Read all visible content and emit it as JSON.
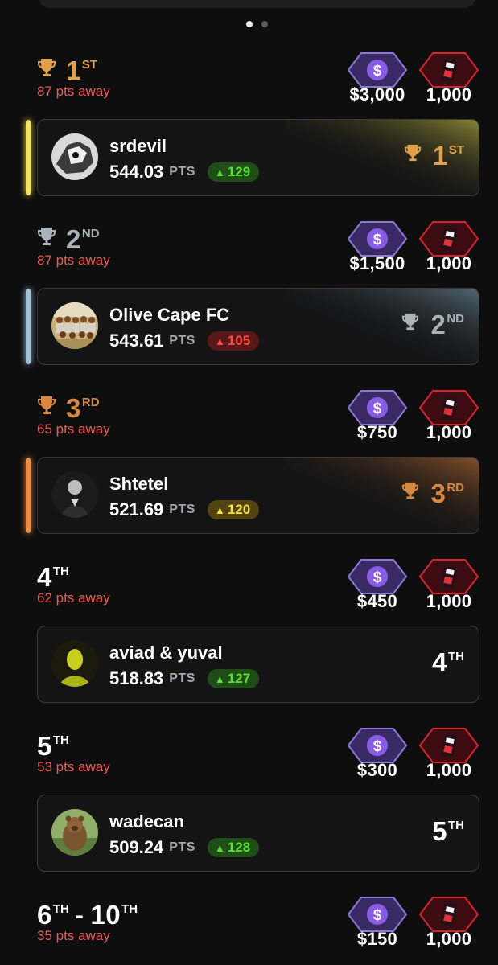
{
  "pager": {
    "dots": [
      "page-1",
      "page-2"
    ],
    "active": 0
  },
  "colors": {
    "gold": "#e0a14a",
    "silver": "#a9b3ba",
    "bronze": "#d9883f",
    "away": "#f0584f"
  },
  "tiers": [
    {
      "rank": "1",
      "suffix": "ST",
      "trophy": "gold",
      "pts_away": "87 pts away",
      "cash": "$3,000",
      "tokens": "1,000"
    },
    {
      "rank": "2",
      "suffix": "ND",
      "trophy": "silver",
      "pts_away": "87 pts away",
      "cash": "$1,500",
      "tokens": "1,000"
    },
    {
      "rank": "3",
      "suffix": "RD",
      "trophy": "bronze",
      "pts_away": "65 pts away",
      "cash": "$750",
      "tokens": "1,000"
    },
    {
      "rank": "4",
      "suffix": "TH",
      "trophy": "",
      "pts_away": "62 pts away",
      "cash": "$450",
      "tokens": "1,000"
    },
    {
      "rank": "5",
      "suffix": "TH",
      "trophy": "",
      "pts_away": "53 pts away",
      "cash": "$300",
      "tokens": "1,000"
    },
    {
      "rank": "6",
      "suffix": "TH",
      "rank_to": "10",
      "suffix_to": "TH",
      "trophy": "",
      "pts_away": "35 pts away",
      "cash": "$150",
      "tokens": "1,000"
    }
  ],
  "entries": [
    {
      "name": "srdevil",
      "score": "544.03",
      "pts_label": "PTS",
      "delta": "129",
      "delta_dir": "up",
      "rank": "1",
      "suffix": "ST",
      "trophy": "gold",
      "accent": "#f3e85a",
      "avatar": "avatar-bw-dog"
    },
    {
      "name": "Olive Cape FC",
      "score": "543.61",
      "pts_label": "PTS",
      "delta": "105",
      "delta_dir": "down",
      "rank": "2",
      "suffix": "ND",
      "trophy": "silver",
      "accent": "#9fc4d6",
      "avatar": "avatar-team-photo"
    },
    {
      "name": "Shtetel",
      "score": "521.69",
      "pts_label": "PTS",
      "delta": "120",
      "delta_dir": "yellow",
      "rank": "3",
      "suffix": "RD",
      "trophy": "bronze",
      "accent": "#f08a3c",
      "avatar": "avatar-bw-portrait"
    },
    {
      "name": "aviad & yuval",
      "score": "518.83",
      "pts_label": "PTS",
      "delta": "127",
      "delta_dir": "up",
      "rank": "4",
      "suffix": "TH",
      "trophy": "",
      "accent": "",
      "avatar": "avatar-yellow-silhouette"
    },
    {
      "name": "wadecan",
      "score": "509.24",
      "pts_label": "PTS",
      "delta": "128",
      "delta_dir": "up",
      "rank": "5",
      "suffix": "TH",
      "trophy": "",
      "accent": "",
      "avatar": "avatar-bear"
    }
  ]
}
